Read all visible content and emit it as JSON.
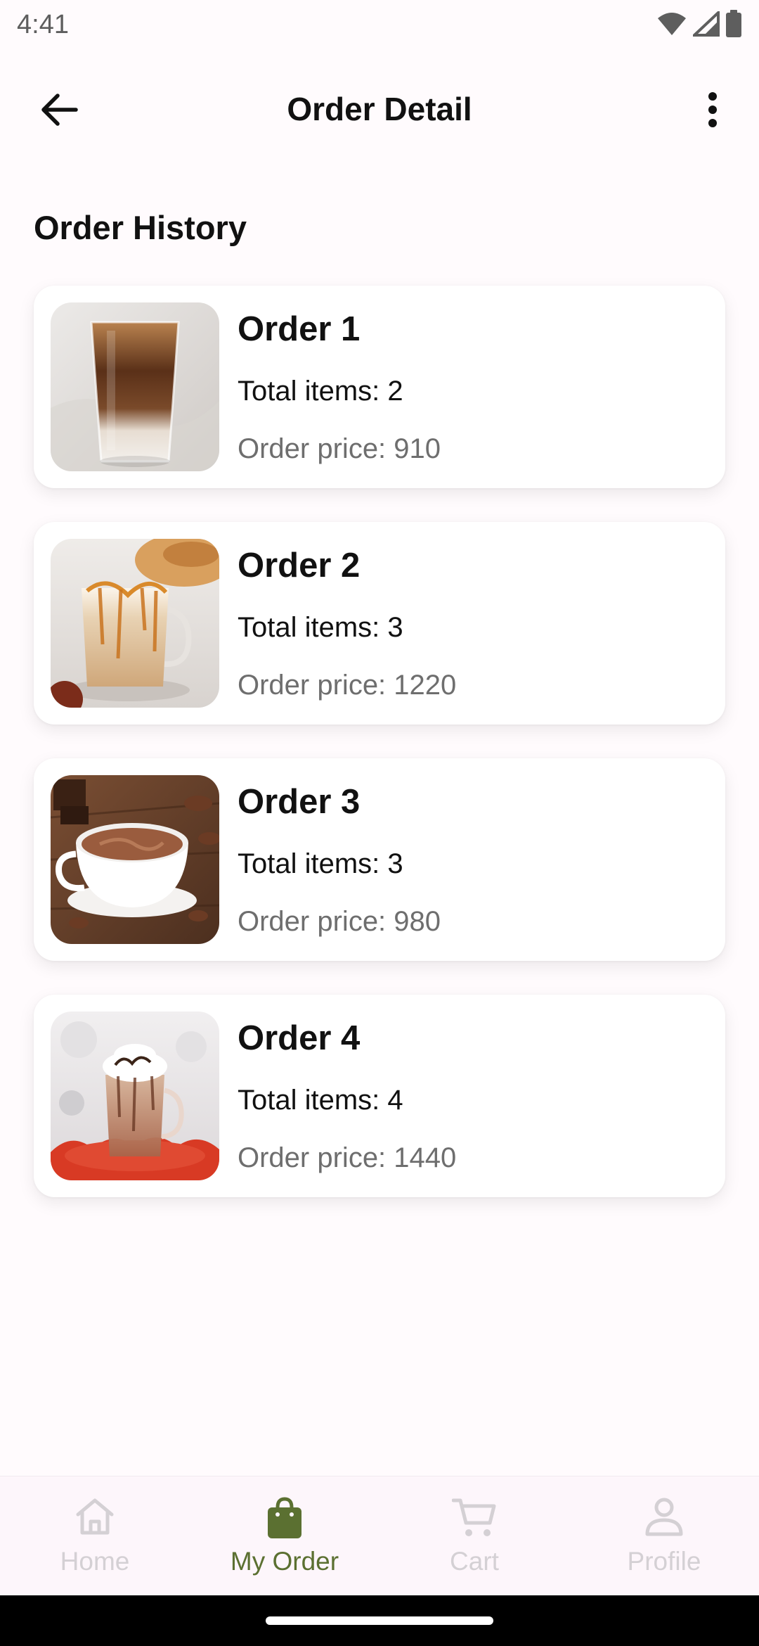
{
  "status_bar": {
    "time": "4:41",
    "icons": [
      "wifi-icon",
      "signal-icon",
      "battery-icon"
    ]
  },
  "app_bar": {
    "title": "Order Detail",
    "back_icon": "back-arrow-icon",
    "more_icon": "more-vert-icon"
  },
  "section": {
    "title": "Order History"
  },
  "orders": [
    {
      "name": "Order 1",
      "items": "Total items: 2",
      "price": "Order price: 910",
      "image": "iced-latte-image"
    },
    {
      "name": "Order 2",
      "items": "Total items: 3",
      "price": "Order price: 1220",
      "image": "caramel-latte-image"
    },
    {
      "name": "Order 3",
      "items": "Total items: 3",
      "price": "Order price: 980",
      "image": "hot-chocolate-image"
    },
    {
      "name": "Order 4",
      "items": "Total items: 4",
      "price": "Order price: 1440",
      "image": "mocha-whipped-image"
    }
  ],
  "bottom_nav": {
    "items": [
      {
        "label": "Home",
        "icon": "home-icon",
        "active": false
      },
      {
        "label": "My Order",
        "icon": "shopping-bag-icon",
        "active": true
      },
      {
        "label": "Cart",
        "icon": "cart-icon",
        "active": false
      },
      {
        "label": "Profile",
        "icon": "profile-icon",
        "active": false
      }
    ]
  },
  "colors": {
    "active_accent": "#5b7031",
    "inactive": "#d4d0d4",
    "background": "#fffbfd",
    "card": "#ffffff"
  }
}
